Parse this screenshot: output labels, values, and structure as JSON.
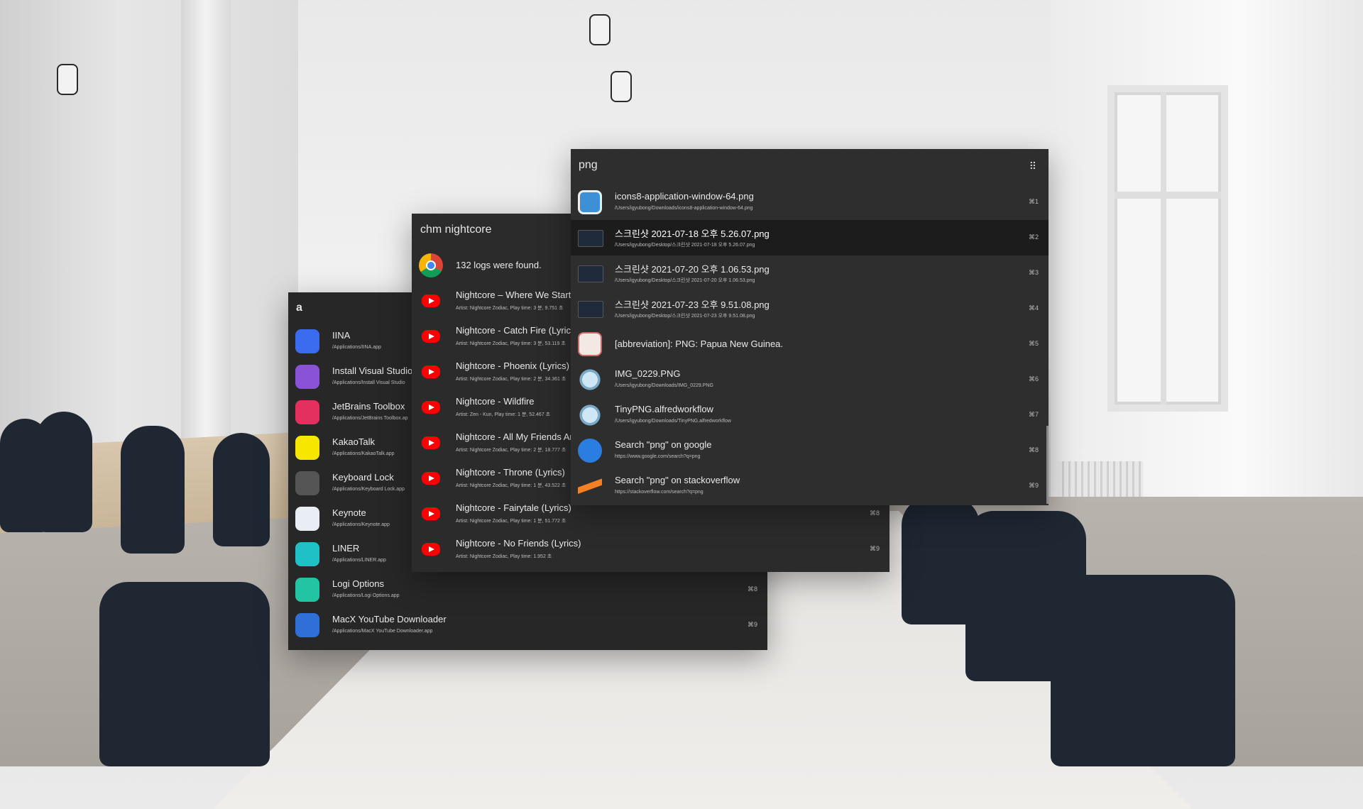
{
  "windowA": {
    "query": "a",
    "rows": [
      {
        "title": "IINA",
        "subtitle": "/Applications/IINA.app",
        "shortcut": "",
        "icon": "iina-icon",
        "color": "#3b6cf0"
      },
      {
        "title": "Install Visual Studio",
        "subtitle": "/Applications/Install Visual Studio",
        "shortcut": "",
        "icon": "visual-studio-icon",
        "color": "#8a52d6"
      },
      {
        "title": "JetBrains Toolbox",
        "subtitle": "/Applications/JetBrains Toolbox.ap",
        "shortcut": "",
        "icon": "jetbrains-icon",
        "color": "#e4305e"
      },
      {
        "title": "KakaoTalk",
        "subtitle": "/Applications/KakaoTalk.app",
        "shortcut": "",
        "icon": "kakaotalk-icon",
        "color": "#f7e600"
      },
      {
        "title": "Keyboard Lock",
        "subtitle": "/Applications/Keyboard Lock.app",
        "shortcut": "",
        "icon": "keyboard-lock-icon",
        "color": "#555555"
      },
      {
        "title": "Keynote",
        "subtitle": "/Applications/Keynote.app",
        "shortcut": "",
        "icon": "keynote-icon",
        "color": "#e9eef5"
      },
      {
        "title": "LINER",
        "subtitle": "/Applications/LINER.app",
        "shortcut": "",
        "icon": "liner-icon",
        "color": "#1fc1c7"
      },
      {
        "title": "Logi Options",
        "subtitle": "/Applications/Logi Options.app",
        "shortcut": "⌘8",
        "icon": "logi-options-icon",
        "color": "#23c4a4"
      },
      {
        "title": "MacX YouTube Downloader",
        "subtitle": "/Applications/MacX YouTube Downloader.app",
        "shortcut": "⌘9",
        "icon": "macx-youtube-icon",
        "color": "#2e6fd8"
      }
    ]
  },
  "windowB": {
    "query": "chm nightcore",
    "rows": [
      {
        "title": "132 logs were found.",
        "subtitle": "",
        "shortcut": "",
        "icon": "chrome-icon"
      },
      {
        "title": "Nightcore – Where We Starte",
        "subtitle": "Artist: Nightcore Zodiac, Play time: 3 분, 9.751 초",
        "shortcut": "",
        "icon": "youtube-icon"
      },
      {
        "title": "Nightcore - Catch Fire (Lyrics",
        "subtitle": "Artist: Nightcore Zodiac, Play time: 3 분, 53.119 초",
        "shortcut": "",
        "icon": "youtube-icon"
      },
      {
        "title": "Nightcore - Phoenix (Lyrics)",
        "subtitle": "Artist: Nightcore Zodiac, Play time: 2 분, 34.361 초",
        "shortcut": "",
        "icon": "youtube-icon"
      },
      {
        "title": "Nightcore - Wildfire",
        "subtitle": "Artist: Zen - Kun, Play time: 1 분, 52.467 초",
        "shortcut": "",
        "icon": "youtube-icon"
      },
      {
        "title": "Nightcore - All My Friends Ar",
        "subtitle": "Artist: Nightcore Zodiac, Play time: 2 분, 18.777 초",
        "shortcut": "",
        "icon": "youtube-icon"
      },
      {
        "title": "Nightcore - Throne (Lyrics)",
        "subtitle": "Artist: Nightcore Zodiac, Play time: 1 분, 43.522 초",
        "shortcut": "",
        "icon": "youtube-icon"
      },
      {
        "title": "Nightcore - Fairytale (Lyrics)",
        "subtitle": "Artist: Nightcore Zodiac, Play time: 1 분, 51.772 초",
        "shortcut": "⌘8",
        "icon": "youtube-icon"
      },
      {
        "title": "Nightcore - No Friends (Lyrics)",
        "subtitle": "Artist: Nightcore Zodiac, Play time: 1.952 초",
        "shortcut": "⌘9",
        "icon": "youtube-icon"
      }
    ]
  },
  "windowC": {
    "query": "png",
    "grip": "⠿",
    "rows": [
      {
        "title": "icons8-application-window-64.png",
        "subtitle": "/Users/igyubong/Downloads/icons8-application-window-64.png",
        "shortcut": "⌘1",
        "icon": "application-window-icon",
        "selected": false
      },
      {
        "title": "스크린샷 2021-07-18 오후 5.26.07.png",
        "subtitle": "/Users/igyubong/Desktop/스크린샷 2021-07-18 오후 5.26.07.png",
        "shortcut": "⌘2",
        "icon": "screenshot-thumbnail-icon",
        "selected": true
      },
      {
        "title": "스크린샷 2021-07-20 오후 1.06.53.png",
        "subtitle": "/Users/igyubong/Desktop/스크린샷 2021-07-20 오후 1.06.53.png",
        "shortcut": "⌘3",
        "icon": "screenshot-thumbnail-icon",
        "selected": false
      },
      {
        "title": "스크린샷 2021-07-23 오후 9.51.08.png",
        "subtitle": "/Users/igyubong/Desktop/스크린샷 2021-07-23 오후 9.51.08.png",
        "shortcut": "⌘4",
        "icon": "screenshot-thumbnail-icon",
        "selected": false
      },
      {
        "title": "[abbreviation]: PNG: Papua New Guinea.",
        "subtitle": "",
        "shortcut": "⌘5",
        "icon": "dictionary-icon",
        "selected": false
      },
      {
        "title": "IMG_0229.PNG",
        "subtitle": "/Users/igyubong/Downloads/IMG_0229.PNG",
        "shortcut": "⌘6",
        "icon": "preview-icon",
        "selected": false
      },
      {
        "title": "TinyPNG.alfredworkflow",
        "subtitle": "/Users/igyubong/Downloads/TinyPNG.alfredworkflow",
        "shortcut": "⌘7",
        "icon": "preview-icon",
        "selected": false
      },
      {
        "title": "Search \"png\" on google",
        "subtitle": "https://www.google.com/search?q=png",
        "shortcut": "⌘8",
        "icon": "google-icon",
        "selected": false
      },
      {
        "title": "Search \"png\" on stackoverflow",
        "subtitle": "https://stackoverflow.com/search?q=png",
        "shortcut": "⌘9",
        "icon": "stackoverflow-icon",
        "selected": false
      }
    ]
  }
}
